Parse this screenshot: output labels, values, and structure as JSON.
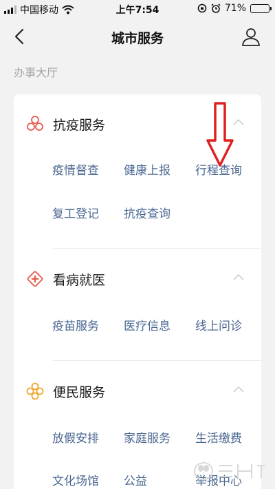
{
  "status": {
    "carrier": "中国移动",
    "time": "上午7:54",
    "battery_percent": "71%",
    "battery_level": 0.71
  },
  "nav": {
    "title": "城市服务"
  },
  "section_label": "办事大厅",
  "groups": [
    {
      "title": "抗疫服务",
      "icon": "pandemic-service-icon",
      "color": "#e8574b",
      "items": [
        "疫情督查",
        "健康上报",
        "行程查询",
        "复工登记",
        "抗疫查询"
      ]
    },
    {
      "title": "看病就医",
      "icon": "medical-cross-icon",
      "color": "#e8574b",
      "items": [
        "疫苗服务",
        "医疗信息",
        "线上问诊"
      ]
    },
    {
      "title": "便民服务",
      "icon": "convenience-service-icon",
      "color": "#f0a732",
      "items": [
        "放假安排",
        "家庭服务",
        "生活缴费",
        "文化场馆",
        "公益",
        "举报中心"
      ]
    }
  ],
  "colors": {
    "link": "#4a6791",
    "annotation_arrow": "#e02020"
  }
}
